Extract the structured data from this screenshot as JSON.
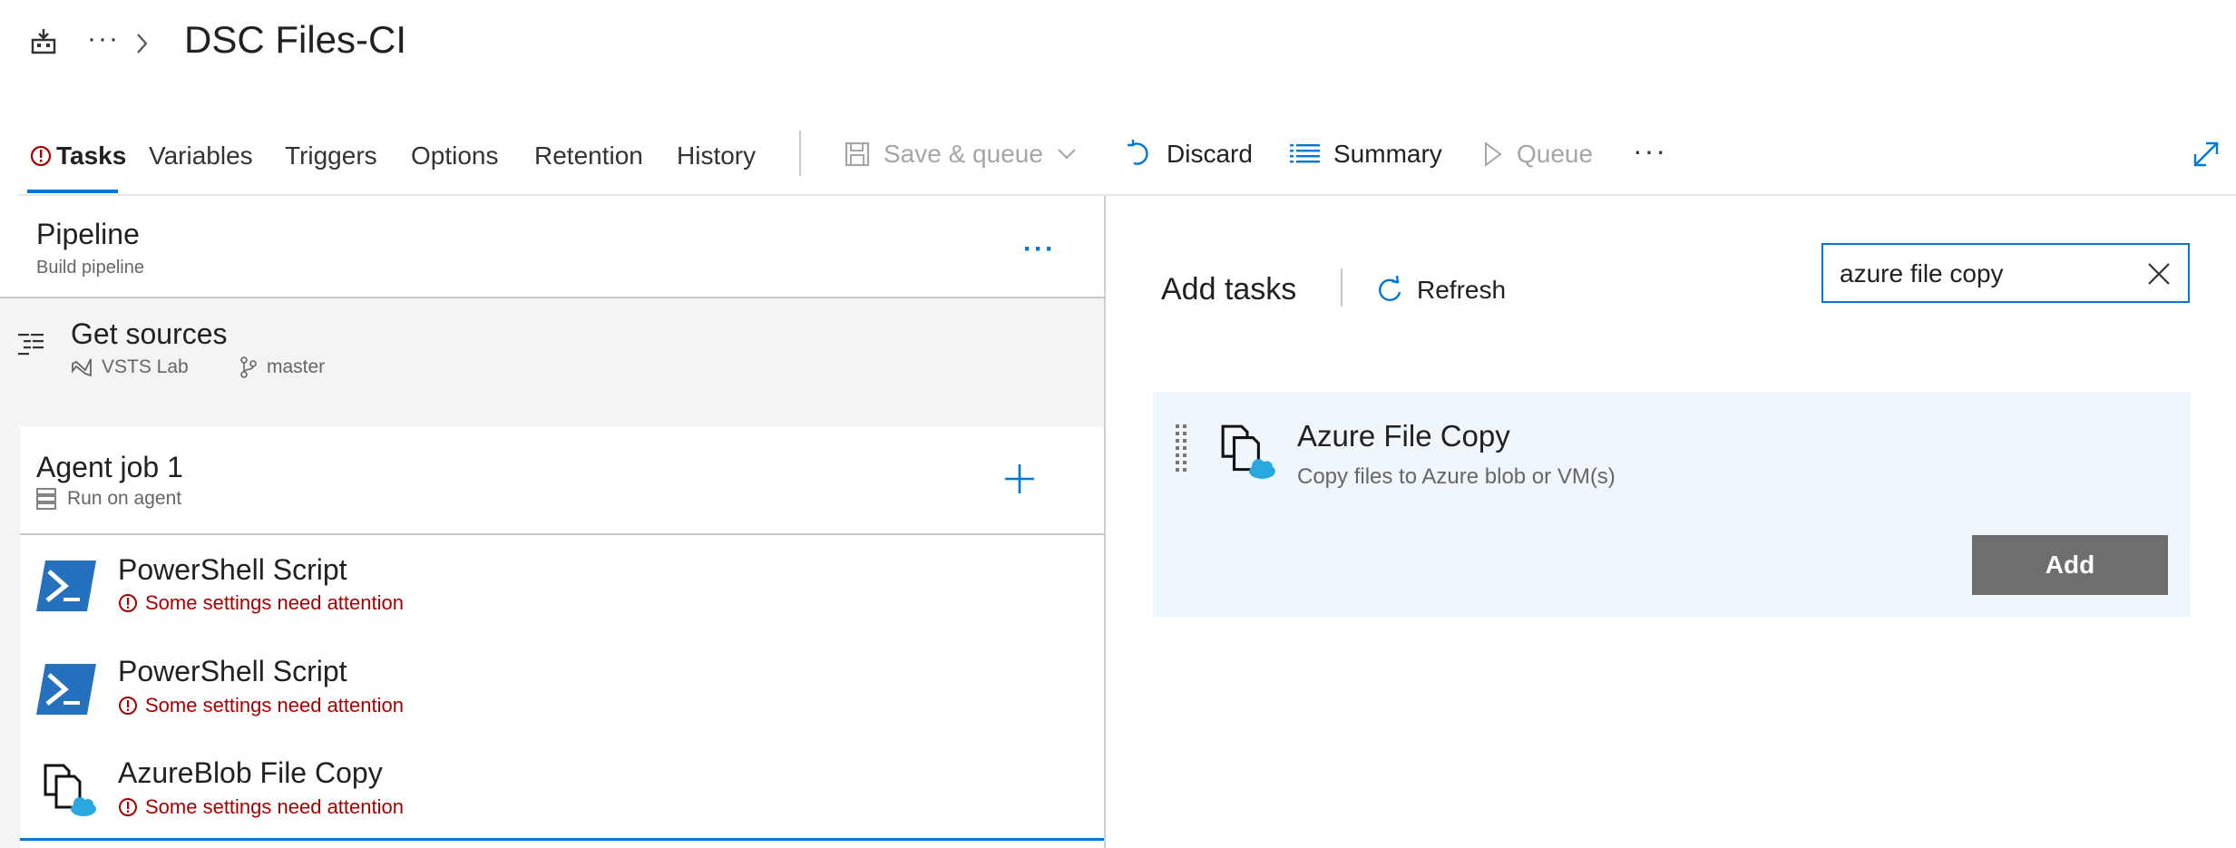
{
  "header": {
    "title": "DSC Files-CI",
    "overflow_glyph": "···"
  },
  "tabs": [
    {
      "label": "Tasks",
      "active": true,
      "has_warning": true
    },
    {
      "label": "Variables"
    },
    {
      "label": "Triggers"
    },
    {
      "label": "Options"
    },
    {
      "label": "Retention"
    },
    {
      "label": "History"
    }
  ],
  "toolbar": {
    "save_queue_label": "Save & queue",
    "discard_label": "Discard",
    "summary_label": "Summary",
    "queue_label": "Queue",
    "more_glyph": "···"
  },
  "pipeline": {
    "title": "Pipeline",
    "subtitle": "Build pipeline",
    "more_glyph": "···"
  },
  "get_sources": {
    "title": "Get sources",
    "repo": "VSTS Lab",
    "branch": "master"
  },
  "agent_job": {
    "title": "Agent job 1",
    "subtitle": "Run on agent"
  },
  "tasks": [
    {
      "name": "PowerShell Script",
      "warning": "Some settings need attention",
      "icon": "powershell-icon"
    },
    {
      "name": "PowerShell Script",
      "warning": "Some settings need attention",
      "icon": "powershell-icon"
    },
    {
      "name": "AzureBlob File Copy",
      "warning": "Some settings need attention",
      "icon": "azure-file-copy-icon"
    }
  ],
  "add_tasks": {
    "title": "Add tasks",
    "refresh_label": "Refresh",
    "search_value": "azure file copy",
    "result": {
      "title": "Azure File Copy",
      "description": "Copy files to Azure blob or VM(s)",
      "add_label": "Add"
    }
  },
  "colors": {
    "accent": "#0078d4",
    "warning": "#a80000",
    "add_button": "#6d6e70",
    "result_bg": "#eff6fc"
  }
}
